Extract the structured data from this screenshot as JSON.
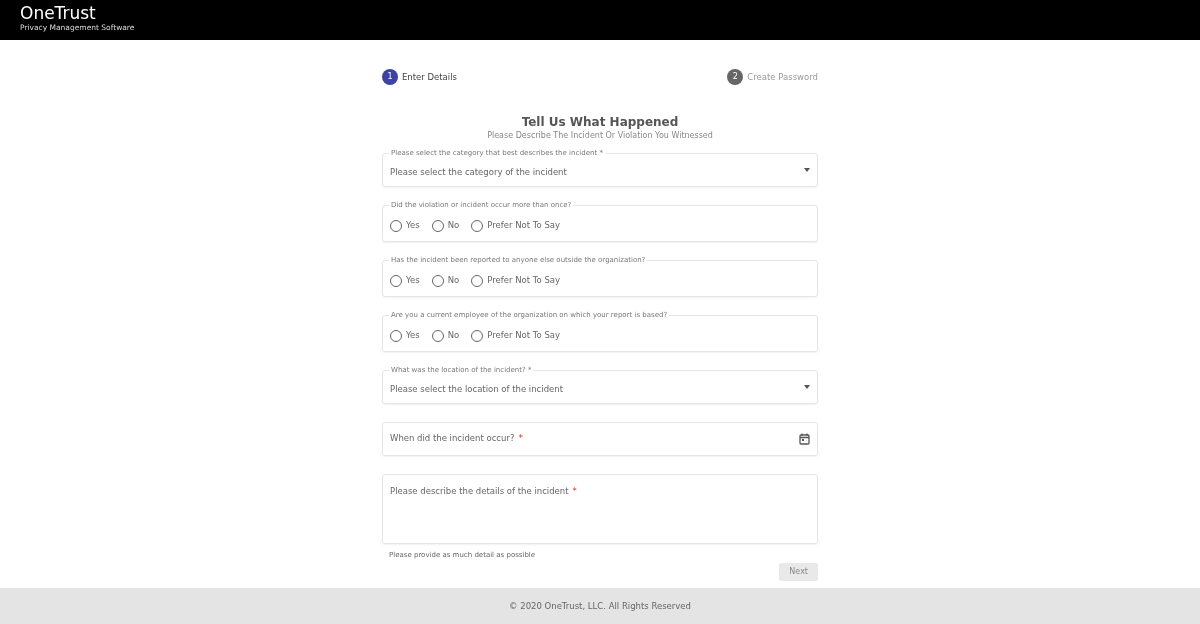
{
  "header": {
    "logo": "OneTrust",
    "tagline": "Privacy Management Software"
  },
  "steps": [
    {
      "number": "1",
      "label": "Enter Details",
      "selected": true
    },
    {
      "number": "2",
      "label": "Create Password",
      "selected": false
    }
  ],
  "title": "Tell Us What Happened",
  "subtitle": "Please Describe The Incident Or Violation You Witnessed",
  "fields": [
    {
      "kind": "select",
      "legend": "Please select the category that best describes the incident *",
      "placeholder": "Please select the category of the incident"
    },
    {
      "kind": "radio",
      "legend": "Did the violation or incident occur more than once?",
      "options": [
        {
          "label": "Yes",
          "selected": false
        },
        {
          "label": "No",
          "selected": false
        },
        {
          "label": "Prefer Not To Say",
          "selected": false
        }
      ]
    },
    {
      "kind": "radio",
      "legend": "Has the incident been reported to anyone else outside the organization?",
      "options": [
        {
          "label": "Yes",
          "selected": false
        },
        {
          "label": "No",
          "selected": false
        },
        {
          "label": "Prefer Not To Say",
          "selected": false
        }
      ]
    },
    {
      "kind": "radio",
      "legend": "Are you a current employee of the organization on which your report is based?",
      "options": [
        {
          "label": "Yes",
          "selected": false
        },
        {
          "label": "No",
          "selected": false
        },
        {
          "label": "Prefer Not To Say",
          "selected": false
        }
      ]
    },
    {
      "kind": "select",
      "legend": "What was the location of the incident? *",
      "placeholder": "Please select the location of the incident"
    },
    {
      "kind": "date",
      "placeholder": "When did the incident occur?",
      "required_mark": "*"
    },
    {
      "kind": "textarea",
      "placeholder": "Please describe the details of the incident",
      "required_mark": "*",
      "hint": "Please provide as much detail as possible"
    }
  ],
  "next_button": {
    "label": "Next",
    "disabled": true
  },
  "footer": "© 2020 OneTrust, LLC. All Rights Reserved"
}
